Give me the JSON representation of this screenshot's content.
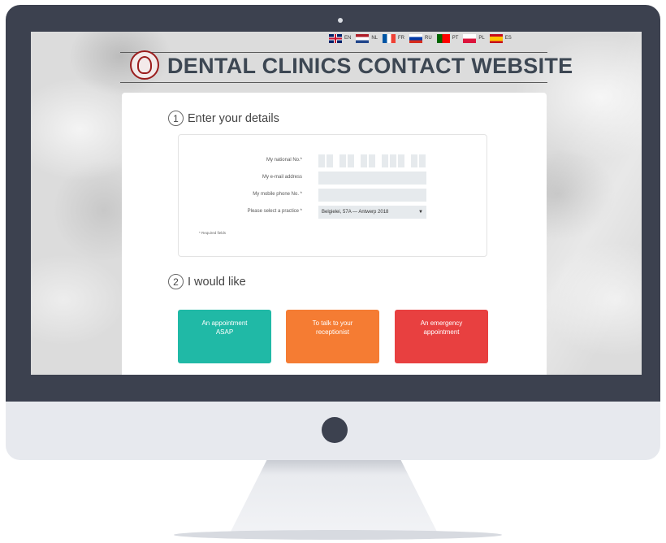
{
  "languages": [
    {
      "code": "EN",
      "flag": "flag-en"
    },
    {
      "code": "NL",
      "flag": "flag-nl"
    },
    {
      "code": "FR",
      "flag": "flag-fr"
    },
    {
      "code": "RU",
      "flag": "flag-ru"
    },
    {
      "code": "PT",
      "flag": "flag-pt"
    },
    {
      "code": "PL",
      "flag": "flag-pl"
    },
    {
      "code": "ES",
      "flag": "flag-es"
    }
  ],
  "header": {
    "title": "DENTAL CLINICS CONTACT WEBSITE"
  },
  "step1": {
    "number": "1",
    "title": "Enter your details",
    "fields": {
      "national_no_label": "My national No.*",
      "email_label": "My e-mail address",
      "mobile_label": "My mobile phone No. *",
      "practice_label": "Please select a practice *",
      "practice_value": "Belgielei, 57A — Antwerp 2018"
    },
    "required_note": "* Required fields"
  },
  "step2": {
    "number": "2",
    "title": "I would like",
    "choices": [
      {
        "label": "An appointment ASAP",
        "color": "#20b9a6"
      },
      {
        "label": "To talk to your receptionist",
        "color": "#f57c33"
      },
      {
        "label": "An emergency appointment",
        "color": "#e84040"
      }
    ]
  },
  "colors": {
    "bezel": "#3c414f",
    "title": "#3d4753",
    "input_bg": "#e6eaed"
  }
}
